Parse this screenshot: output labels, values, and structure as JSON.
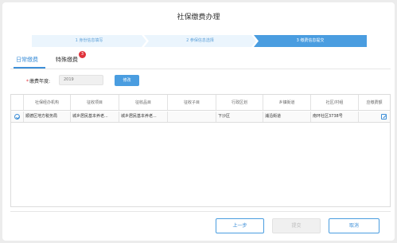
{
  "page": {
    "title": "社保缴费办理"
  },
  "steps": [
    {
      "label": "1 身份信息填写"
    },
    {
      "label": "2 参保信息选择"
    },
    {
      "label": "3 缴费信息提交"
    }
  ],
  "tabs": {
    "daily": "日常缴费",
    "special": "特殊缴费",
    "special_badge": "3"
  },
  "form": {
    "required_mark": "*",
    "year_label": "缴费年度:",
    "year_value": "2019",
    "modify_button": "修改"
  },
  "table": {
    "headers": [
      "社保经办机构",
      "征收项目",
      "征收品目",
      "征收子目",
      "行政区划",
      "乡镇街道",
      "社区/村组",
      "应缴费额"
    ],
    "rows": [
      {
        "selected": true,
        "agency": "顺德区地方税务局",
        "item": "城乡居民基本养老...",
        "category": "城乡居民基本养老...",
        "subcategory": "",
        "district": "下沙区",
        "street": "浦沿街道",
        "community": "南环社区3738号"
      }
    ]
  },
  "footer": {
    "prev": "上一步",
    "submit": "提交",
    "cancel": "取消"
  },
  "colors": {
    "accent": "#4a9de0",
    "badge": "#e0333c"
  }
}
